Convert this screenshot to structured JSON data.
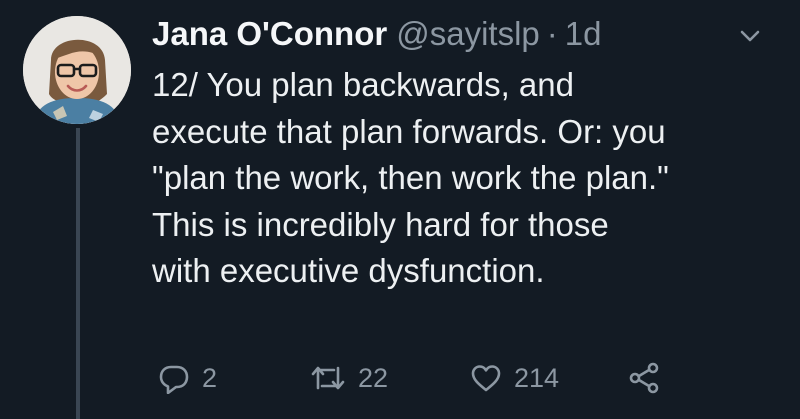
{
  "tweet": {
    "author_name": "Jana O'Connor",
    "handle": "@sayitslp",
    "separator": "·",
    "time": "1d",
    "text_lines": [
      "12/ You plan backwards, and",
      "execute that plan forwards. Or: you",
      "\"plan the work, then work the plan.\"",
      "This is incredibly hard for those",
      "with executive dysfunction."
    ],
    "replies": "2",
    "retweets": "22",
    "likes": "214"
  },
  "colors": {
    "background": "#131b24",
    "text": "#edf0f2",
    "muted": "#8c97a2",
    "thread_line": "#3a4653"
  },
  "icons": [
    "reply-icon",
    "retweet-icon",
    "like-icon",
    "share-icon",
    "chevron-down-icon"
  ]
}
